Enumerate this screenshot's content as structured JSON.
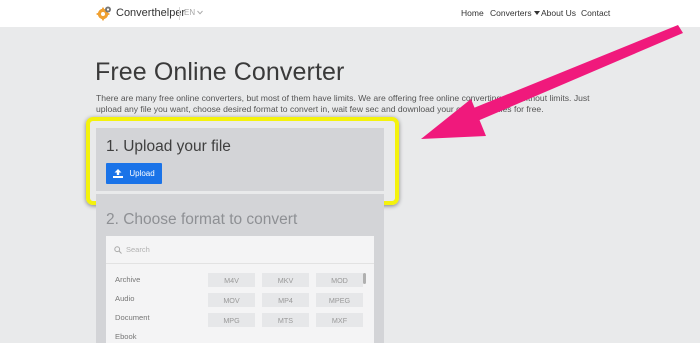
{
  "nav": {
    "brand": "Converthelper",
    "lang": "EN",
    "links": [
      "Home",
      "Converters",
      "About Us",
      "Contact"
    ]
  },
  "page": {
    "title": "Free Online Converter",
    "intro": "There are many free online converters, but most of them have limits. We are offering free online converting tool without limits. Just upload any file you want, choose desired format to convert in, wait few sec and download your converted files for free."
  },
  "upload_panel": {
    "title": "1. Upload your file",
    "button_label": "Upload"
  },
  "format_panel": {
    "title": "2. Choose format to convert",
    "search_placeholder": "Search",
    "categories": [
      "Archive",
      "Audio",
      "Document",
      "Ebook"
    ],
    "formats": [
      "M4V",
      "MKV",
      "MOD",
      "MOV",
      "MP4",
      "MPEG",
      "MPG",
      "MTS",
      "MXF"
    ]
  },
  "colors": {
    "accent_button": "#1a73e8",
    "highlight_border": "#f4f20c",
    "annotation_arrow": "#f0197c",
    "page_background": "#e9eaeb",
    "panel_background": "#d3d4d7"
  },
  "icons": {
    "logo": "gear-logo-icon",
    "lang_dropdown": "chevron-down-icon",
    "converters_dropdown": "caret-down-icon",
    "upload": "upload-icon",
    "search": "search-icon"
  }
}
